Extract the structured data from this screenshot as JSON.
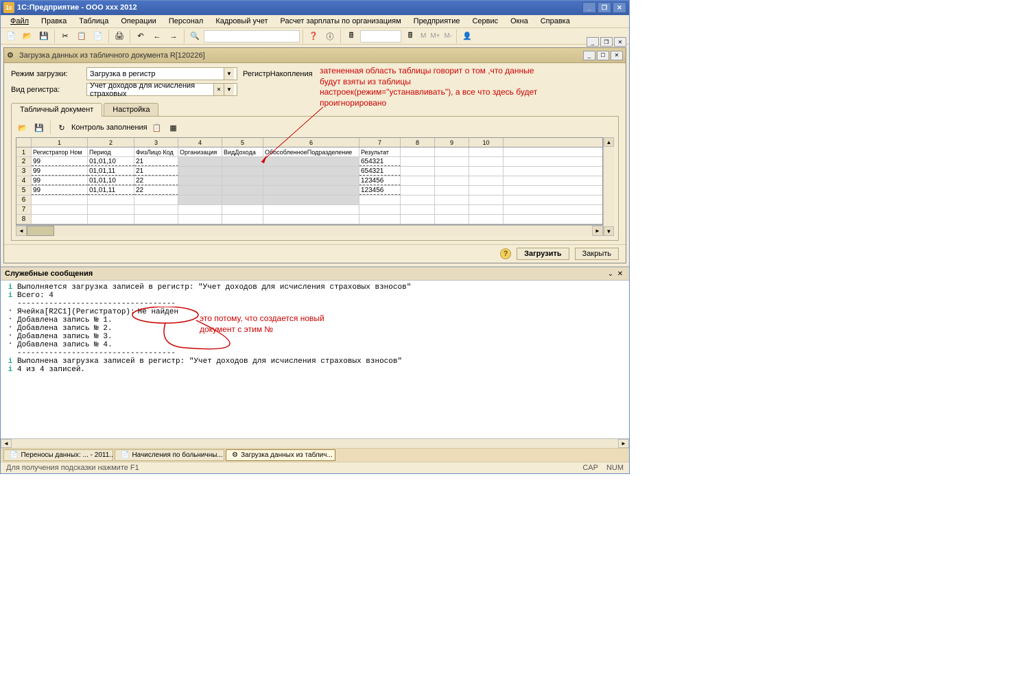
{
  "titlebar": {
    "title": "1С:Предприятие - ООО xxx 2012"
  },
  "menu": [
    "Файл",
    "Правка",
    "Таблица",
    "Операции",
    "Персонал",
    "Кадровый учет",
    "Расчет зарплаты по организациям",
    "Предприятие",
    "Сервис",
    "Окна",
    "Справка"
  ],
  "inner": {
    "title": "Загрузка данных из табличного документа R[120226]"
  },
  "form": {
    "mode_label": "Режим загрузки:",
    "mode_value": "Загрузка в регистр",
    "mode_right": "РегистрНакопления",
    "reg_label": "Вид регистра:",
    "reg_value": "Учет доходов для исчисления страховых"
  },
  "tabs": {
    "tab1": "Табличный документ",
    "tab2": "Настройка"
  },
  "subtoolbar": {
    "control": "Контроль заполнения"
  },
  "colnums": [
    "",
    "1",
    "2",
    "3",
    "4",
    "5",
    "6",
    "7",
    "8",
    "9",
    "10"
  ],
  "headers": [
    "",
    "Регистратор Ном",
    "Период",
    "ФизЛицо Код",
    "Организация",
    "ВидДохода",
    "ОбособленноеПодразделение",
    "Результат",
    "",
    "",
    ""
  ],
  "rows": [
    {
      "n": "2",
      "r1": "99",
      "r2": "01,01,10",
      "r3": "21",
      "r4": "",
      "r5": "",
      "r6": "",
      "r7": "654321"
    },
    {
      "n": "3",
      "r1": "99",
      "r2": "01,01,11",
      "r3": "21",
      "r4": "",
      "r5": "",
      "r6": "",
      "r7": "654321"
    },
    {
      "n": "4",
      "r1": "99",
      "r2": "01,01,10",
      "r3": "22",
      "r4": "",
      "r5": "",
      "r6": "",
      "r7": "123456"
    },
    {
      "n": "5",
      "r1": "99",
      "r2": "01,01,11",
      "r3": "22",
      "r4": "",
      "r5": "",
      "r6": "",
      "r7": "123456"
    }
  ],
  "empty_rows": [
    "6",
    "7",
    "8"
  ],
  "first_row_n": "1",
  "buttons": {
    "load": "Загрузить",
    "close": "Закрыть"
  },
  "messages": {
    "title": "Служебные сообщения",
    "l1": "Выполняется загрузка записей в регистр: \"Учет доходов для исчисления страховых взносов\"",
    "l2": "Всего: 4",
    "sep": "-----------------------------------",
    "l3a": "Ячейка[R2C1](Регистратор):",
    "l3b": "Не найден",
    "l4": "Добавлена запись № 1.",
    "l5": "Добавлена запись № 2.",
    "l6": "Добавлена запись № 3.",
    "l7": "Добавлена запись № 4.",
    "l8": "Выполнена загрузка записей в регистр: \"Учет доходов для исчисления страховых взносов\"",
    "l9": "4 из 4 записей."
  },
  "annotations": {
    "a1": "затененная область таблицы говорит о том ,что данные будут взяты из таблицы настроек(режим=\"устанавливать\"),  а все что здесь будет проигнорировано",
    "a2": "это потому, что создается новый документ с этим №"
  },
  "taskbar": {
    "t1": "Переносы данных: ... - 2011...",
    "t2": "Начисления по больничны...",
    "t3": "Загрузка данных из таблич..."
  },
  "statusbar": {
    "hint": "Для получения подсказки нажмите F1",
    "cap": "CAP",
    "num": "NUM"
  },
  "toolbar_txt": {
    "m": "M",
    "mp": "M+",
    "mm": "M-"
  }
}
